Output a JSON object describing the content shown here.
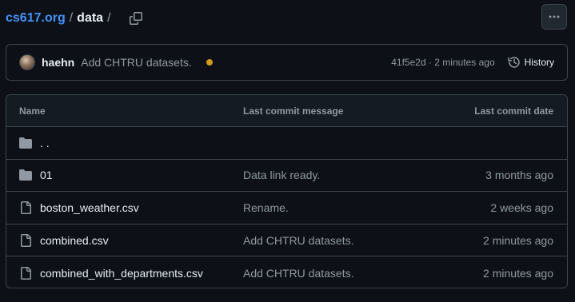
{
  "breadcrumb": {
    "repo": "cs617.org",
    "separator": "/",
    "current": "data",
    "trailing_separator": "/"
  },
  "commit": {
    "author": "haehn",
    "message": "Add CHTRU datasets.",
    "status_color": "#d29922",
    "meta": "41f5e2d · 2 minutes ago",
    "history_label": "History"
  },
  "table": {
    "headers": {
      "name": "Name",
      "message": "Last commit message",
      "date": "Last commit date"
    },
    "rows": [
      {
        "name": ". .",
        "icon": "folder-icon",
        "message": "",
        "date": ""
      },
      {
        "name": "01",
        "icon": "folder-icon",
        "message": "Data link ready.",
        "date": "3 months ago"
      },
      {
        "name": "boston_weather.csv",
        "icon": "file-icon",
        "message": "Rename.",
        "date": "2 weeks ago"
      },
      {
        "name": "combined.csv",
        "icon": "file-icon",
        "message": "Add CHTRU datasets.",
        "date": "2 minutes ago"
      },
      {
        "name": "combined_with_departments.csv",
        "icon": "file-icon",
        "message": "Add CHTRU datasets.",
        "date": "2 minutes ago"
      }
    ]
  },
  "colors": {
    "background": "#0d1117",
    "link": "#4493f8",
    "muted": "#9198a1",
    "border": "#3d444d"
  }
}
